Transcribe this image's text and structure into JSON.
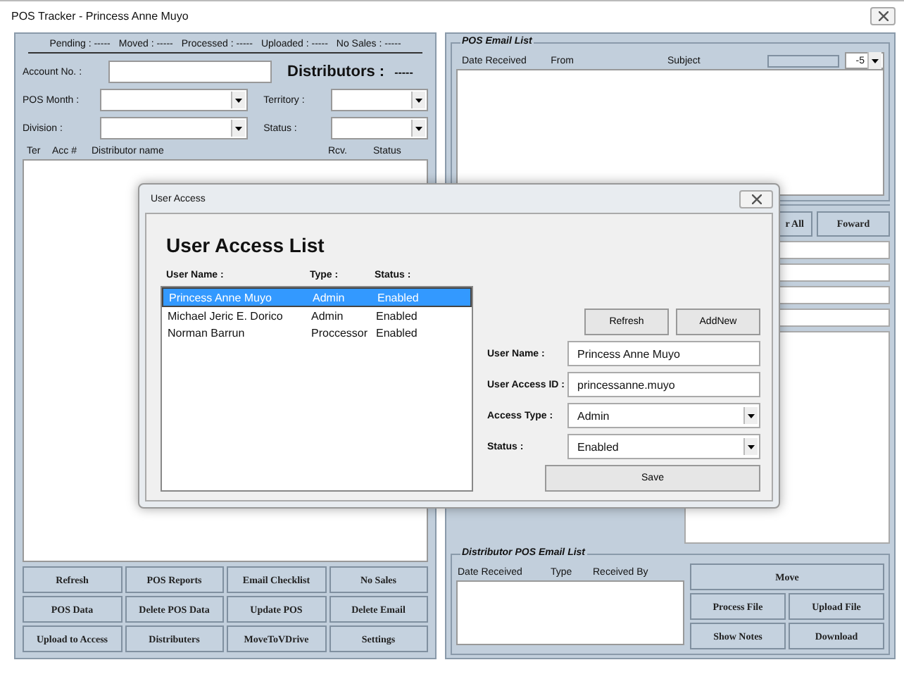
{
  "window": {
    "title": "POS Tracker - Princess Anne Muyo"
  },
  "left_panel": {
    "stats": [
      {
        "label": "Pending :",
        "value": "-----"
      },
      {
        "label": "Moved :",
        "value": "-----"
      },
      {
        "label": "Processed :",
        "value": "-----"
      },
      {
        "label": "Uploaded :",
        "value": "-----"
      },
      {
        "label": "No Sales :",
        "value": "-----"
      }
    ],
    "account_label": "Account No. :",
    "distributors_label": "Distributors  :",
    "distributors_value": "-----",
    "filters": [
      {
        "label": "POS Month :"
      },
      {
        "label": "Territory :"
      },
      {
        "label": "Division :"
      },
      {
        "label": "Status :"
      }
    ],
    "columns": [
      "Ter",
      "Acc #",
      "Distributor name",
      "Rcv.",
      "Status"
    ],
    "buttons": [
      "Refresh",
      "POS Reports",
      "Email Checklist",
      "No Sales",
      "POS Data",
      "Delete POS Data",
      "Update POS",
      "Delete Email",
      "Upload to Access",
      "Distributers",
      "MoveToVDrive",
      "Settings"
    ]
  },
  "right_panel": {
    "email_list": {
      "title": "POS Email List",
      "columns": [
        "Date Received",
        "From",
        "Subject"
      ],
      "days": "-5"
    },
    "actions": [
      "r All",
      "Foward"
    ],
    "distributor_list": {
      "title": "Distributor POS Email List",
      "columns": [
        "Date Received",
        "Type",
        "Received By"
      ],
      "buttons": [
        "Move",
        "Process File",
        "Upload File",
        "Show Notes",
        "Download"
      ]
    }
  },
  "dialog": {
    "title": "User Access",
    "heading": "User Access List",
    "columns": [
      "User Name :",
      "Type :",
      "Status :"
    ],
    "users": [
      {
        "name": "Princess Anne Muyo",
        "type": "Admin",
        "status": "Enabled",
        "selected": true
      },
      {
        "name": "Michael Jeric E. Dorico",
        "type": "Admin",
        "status": "Enabled",
        "selected": false
      },
      {
        "name": "Norman Barrun",
        "type": "Proccessor",
        "status": "Enabled",
        "selected": false
      }
    ],
    "buttons": [
      "Refresh",
      "AddNew"
    ],
    "form": [
      {
        "label": "User Name :",
        "value": "Princess Anne Muyo",
        "kind": "text"
      },
      {
        "label": "User Access ID :",
        "value": "princessanne.muyo",
        "kind": "text"
      },
      {
        "label": "Access Type :",
        "value": "Admin",
        "kind": "dropdown"
      },
      {
        "label": "Status :",
        "value": "Enabled",
        "kind": "dropdown"
      }
    ],
    "save": "Save"
  }
}
